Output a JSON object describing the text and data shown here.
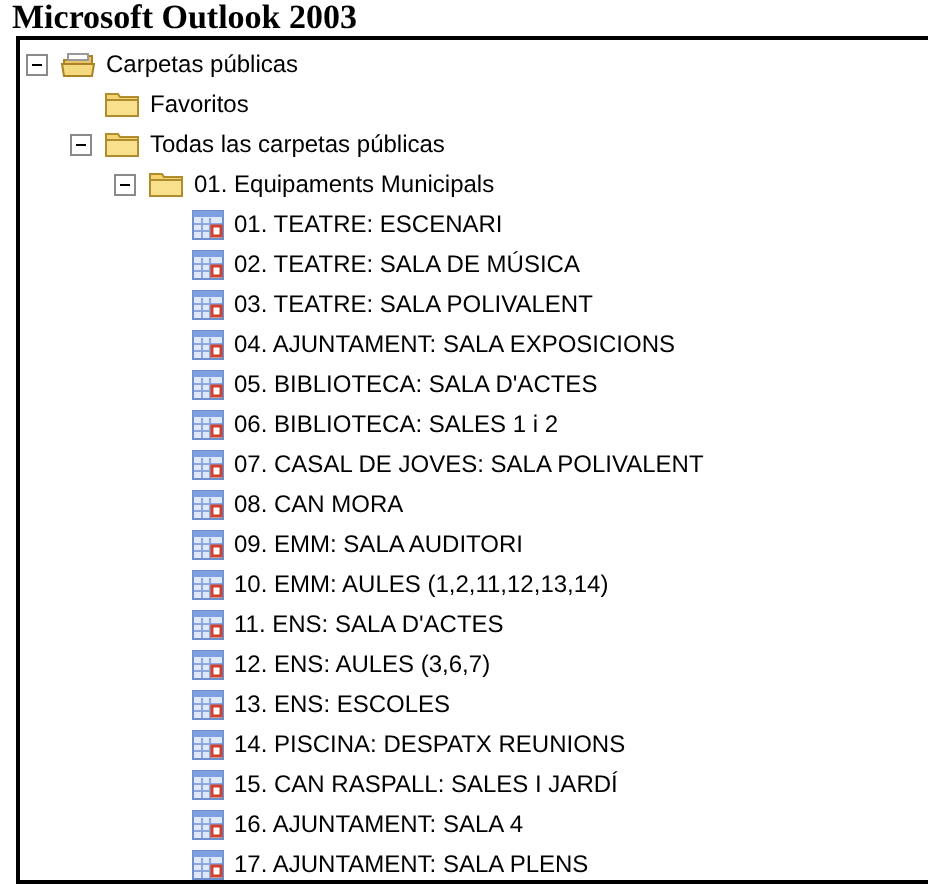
{
  "heading": "Microsoft Outlook 2003",
  "tree": [
    {
      "label": "Carpetas públicas",
      "kind": "root",
      "expanded": true,
      "children": [
        {
          "label": "Favoritos",
          "kind": "folder"
        },
        {
          "label": "Todas las carpetas públicas",
          "kind": "folder",
          "expanded": true,
          "children": [
            {
              "label": "01. Equipaments Municipals",
              "kind": "folder",
              "expanded": true,
              "children": [
                {
                  "label": "01. TEATRE: ESCENARI",
                  "kind": "calendar"
                },
                {
                  "label": "02. TEATRE: SALA DE MÚSICA",
                  "kind": "calendar"
                },
                {
                  "label": "03. TEATRE: SALA POLIVALENT",
                  "kind": "calendar"
                },
                {
                  "label": "04. AJUNTAMENT: SALA EXPOSICIONS",
                  "kind": "calendar"
                },
                {
                  "label": "05. BIBLIOTECA: SALA D'ACTES",
                  "kind": "calendar"
                },
                {
                  "label": "06. BIBLIOTECA: SALES 1 i 2",
                  "kind": "calendar"
                },
                {
                  "label": "07. CASAL DE JOVES: SALA POLIVALENT",
                  "kind": "calendar"
                },
                {
                  "label": "08. CAN MORA",
                  "kind": "calendar"
                },
                {
                  "label": "09. EMM: SALA AUDITORI",
                  "kind": "calendar"
                },
                {
                  "label": "10. EMM: AULES (1,2,11,12,13,14)",
                  "kind": "calendar"
                },
                {
                  "label": "11. ENS: SALA D'ACTES",
                  "kind": "calendar"
                },
                {
                  "label": "12. ENS: AULES (3,6,7)",
                  "kind": "calendar"
                },
                {
                  "label": "13. ENS: ESCOLES",
                  "kind": "calendar"
                },
                {
                  "label": "14. PISCINA: DESPATX REUNIONS",
                  "kind": "calendar"
                },
                {
                  "label": "15. CAN RASPALL: SALES I JARDÍ",
                  "kind": "calendar"
                },
                {
                  "label": "16. AJUNTAMENT: SALA 4",
                  "kind": "calendar"
                },
                {
                  "label": "17. AJUNTAMENT: SALA PLENS",
                  "kind": "calendar"
                }
              ]
            }
          ]
        }
      ]
    }
  ]
}
